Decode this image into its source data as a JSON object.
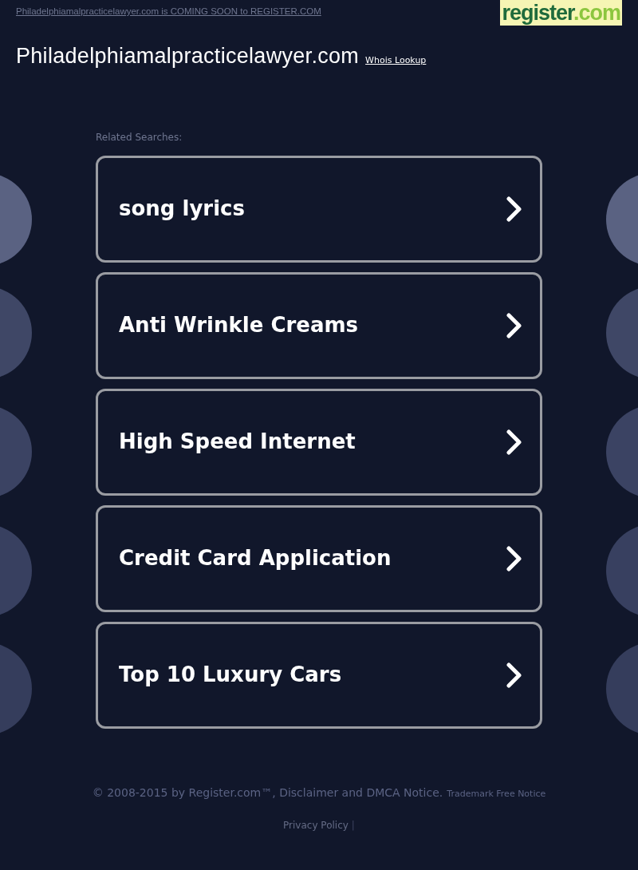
{
  "header": {
    "notice_link": "Philadelphiamalpracticelawyer.com is COMING SOON to REGISTER.COM",
    "logo": {
      "name": "register",
      "suffix": ".com"
    }
  },
  "domain": {
    "title": "Philadelphiamalpracticelawyer.com",
    "whois_link": "Whois Lookup"
  },
  "related": {
    "heading": "Related Searches:",
    "items": [
      {
        "label": "song lyrics"
      },
      {
        "label": "Anti Wrinkle Creams"
      },
      {
        "label": "High Speed Internet"
      },
      {
        "label": "Credit Card Application"
      },
      {
        "label": "Top 10 Luxury Cars"
      }
    ]
  },
  "footer": {
    "copyright": "© 2008-2015 by Register.com™, Disclaimer and DMCA Notice.",
    "trademark": "Trademark Free Notice",
    "links": [
      "Privacy Policy"
    ],
    "separator": "|"
  }
}
